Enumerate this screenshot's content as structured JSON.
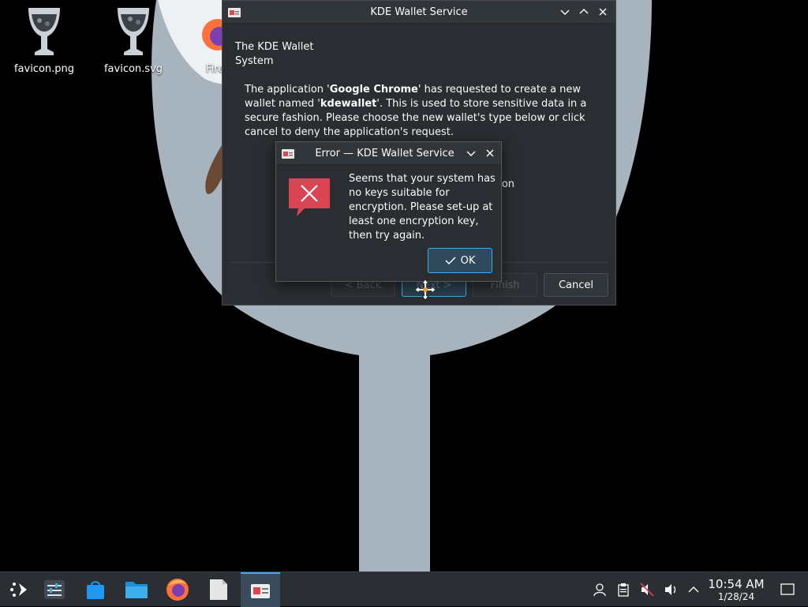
{
  "desktop": {
    "icons": [
      {
        "label": "favicon.png"
      },
      {
        "label": "favicon.svg"
      },
      {
        "label": "Fire"
      }
    ]
  },
  "wallet_dialog": {
    "title": "KDE Wallet Service",
    "heading": "The KDE Wallet System",
    "body_pre_app": "The application '",
    "app_name": "Google Chrome",
    "body_mid": "' has requested to create a new wallet named '",
    "wallet_name": "kdewallet",
    "body_post": "'. This is used to store sensitive data in a secure fashion. Please choose the new wallet's type below or click cancel to deny the application's request.",
    "option_partial": "ection",
    "buttons": {
      "back": "< Back",
      "next": "Next >",
      "finish": "Finish",
      "cancel": "Cancel"
    }
  },
  "error_dialog": {
    "title": "Error — KDE Wallet Service",
    "message": "Seems that your system has no keys suitable for encryption. Please set-up at least one encryption key, then try again.",
    "ok_label": "OK"
  },
  "taskbar": {
    "apps": [
      "application-launcher",
      "system-settings",
      "discover",
      "dolphin-files",
      "firefox",
      "text-file",
      "kde-wallet"
    ],
    "clock": {
      "time": "10:54 AM",
      "date": "1/28/24"
    }
  },
  "colors": {
    "accent": "#3daee9",
    "error_red": "#da4453",
    "dialog_bg": "#2a2e32",
    "taskbar_bg": "#2b2f33"
  }
}
